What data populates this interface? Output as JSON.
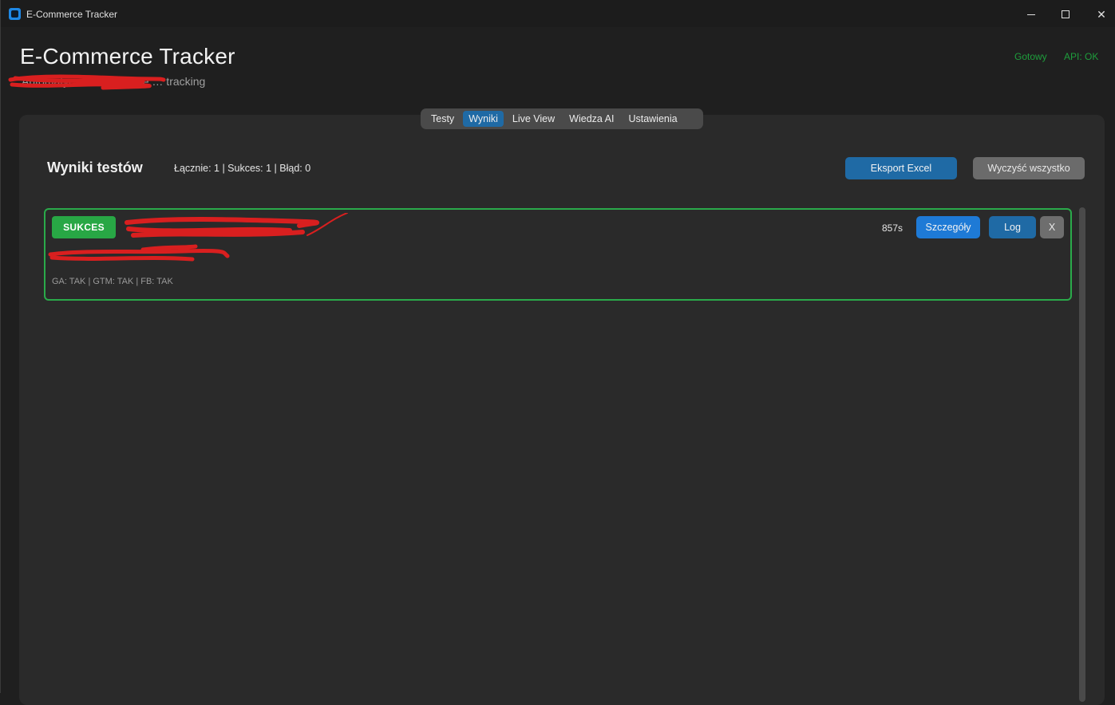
{
  "window": {
    "title": "E-Commerce Tracker",
    "icons": {
      "app": "app-icon",
      "minimize": "minimize-icon",
      "maximize": "maximize-icon",
      "close": "close-icon"
    }
  },
  "header": {
    "title": "E-Commerce Tracker",
    "subtitle": "Automatyczne testowanie … tracking",
    "status_ready": "Gotowy",
    "status_api": "API: OK",
    "status_color": "#1e9e3c"
  },
  "tabs": [
    {
      "label": "Testy",
      "active": false
    },
    {
      "label": "Wyniki",
      "active": true
    },
    {
      "label": "Live View",
      "active": false
    },
    {
      "label": "Wiedza AI",
      "active": false
    },
    {
      "label": "Ustawienia",
      "active": false
    }
  ],
  "results": {
    "title": "Wyniki testów",
    "summary": "Łącznie: 1 | Sukces: 1 | Błąd: 0",
    "export_label": "Eksport Excel",
    "clear_label": "Wyczyść wszystko",
    "items": [
      {
        "status": "SUKCES",
        "name": "",
        "url": "",
        "meta": "GA: TAK | GTM: TAK | FB: TAK",
        "duration": "857s",
        "details_label": "Szczegóły",
        "log_label": "Log",
        "remove_label": "X"
      }
    ]
  },
  "colors": {
    "accent": "#1f6aa5",
    "success": "#28a745",
    "card_border": "#2aaa4a",
    "background": "#1f1f1f",
    "panel": "#2a2a2a"
  }
}
